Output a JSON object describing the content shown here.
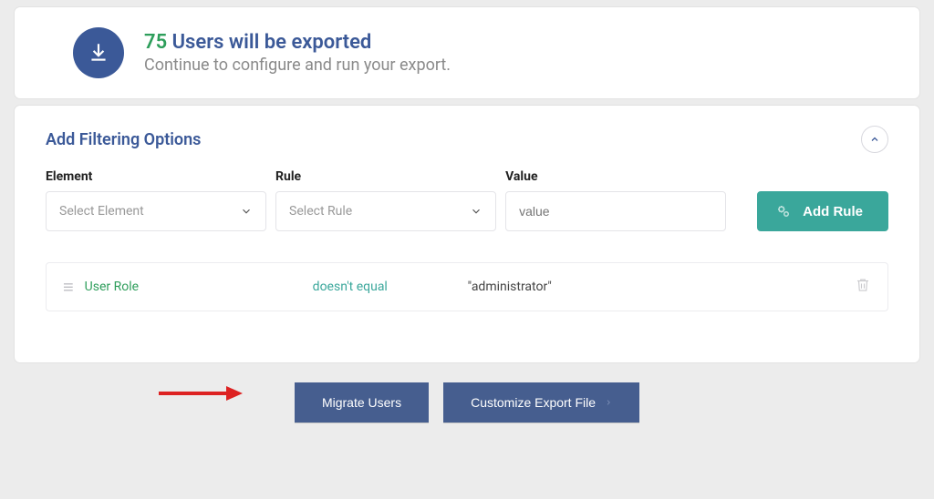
{
  "summary": {
    "count": "75",
    "title_rest": " Users will be exported",
    "subtitle": "Continue to configure and run your export."
  },
  "filter": {
    "title": "Add Filtering Options",
    "labels": {
      "element": "Element",
      "rule": "Rule",
      "value": "Value"
    },
    "placeholders": {
      "element": "Select Element",
      "rule": "Select Rule",
      "value": "value"
    },
    "add_rule_label": "Add Rule",
    "rules": [
      {
        "element": "User Role",
        "condition": "doesn't equal",
        "value": "\"administrator\""
      }
    ]
  },
  "actions": {
    "migrate": "Migrate Users",
    "customize": "Customize Export File"
  }
}
